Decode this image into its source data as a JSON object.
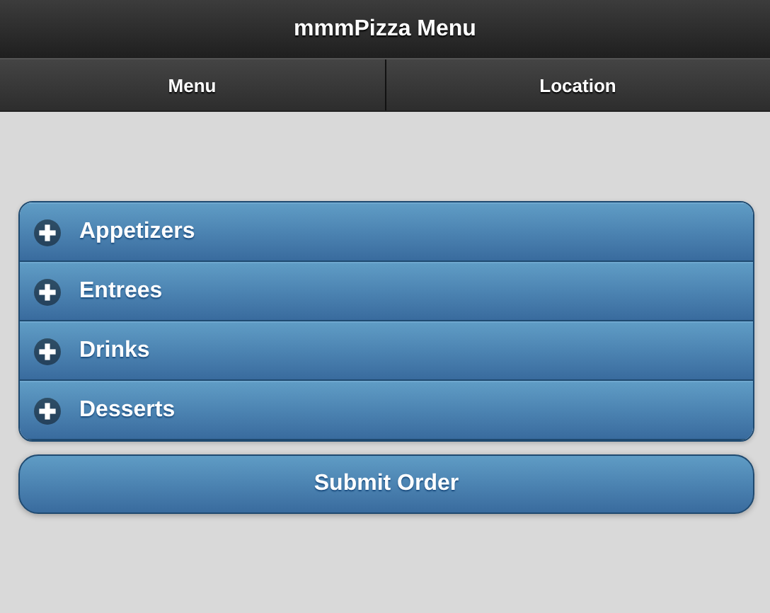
{
  "header": {
    "title": "mmmPizza Menu"
  },
  "navbar": [
    {
      "label": "Menu",
      "selected": false
    },
    {
      "label": "Location",
      "selected": false
    }
  ],
  "sections": [
    {
      "title": "Appetizers",
      "expanded": false
    },
    {
      "title": "Entrees",
      "expanded": false
    },
    {
      "title": "Drinks",
      "expanded": false
    },
    {
      "title": "Desserts",
      "expanded": false
    }
  ],
  "submit_button": {
    "label": "Submit Order"
  }
}
